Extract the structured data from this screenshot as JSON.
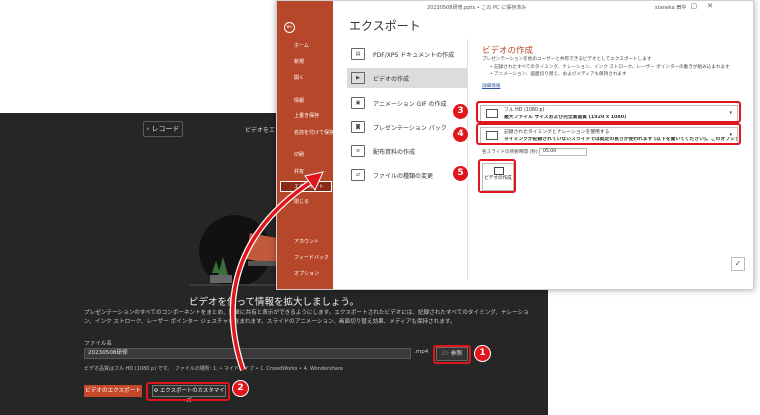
{
  "recorder": {
    "back_label": "レコード",
    "top_title": "ビデオをエクスポート",
    "heading": "ビデオを使って情報を拡大しましょう。",
    "description": "プレゼンテーションのすべてのコンポーネントをまとめ、簡単に共有と表示ができるようにします。エクスポートされたビデオには、記録されたすべてのタイミング、ナレーション、インク ストローク、レーザー ポインター ジェスチャが含まれます。スライドのアニメーション、画面切り替え効果、メディアも保持されます。",
    "filename_label": "ファイル名",
    "filename_value": "20230508研修",
    "extension": ".mp4",
    "browse_label": "参照",
    "quality_text": "ビデオ品質はフル HD (1080 p) です。　ファイルの場所: 1. • マイドライブ • 1. CrowdWorks • 4. Wondershare",
    "export_button": "ビデオのエクスポート",
    "customize_button": "エクスポートのカスタマイズ"
  },
  "ppt": {
    "filename": "20230508研修.pptx • この PC に保存済み",
    "user": "staneka 田中",
    "nav": [
      {
        "label": "ホーム",
        "icon": "home-icon"
      },
      {
        "label": "新規",
        "icon": "new-icon"
      },
      {
        "label": "開く",
        "icon": "open-icon"
      },
      {
        "label": "情報"
      },
      {
        "label": "上書き保存"
      },
      {
        "label": "名前を付けて保存"
      },
      {
        "label": "印刷"
      },
      {
        "label": "共有"
      },
      {
        "label": "エクスポート",
        "selected": true
      },
      {
        "label": "閉じる"
      },
      {
        "label": "アカウント"
      },
      {
        "label": "フィードバック"
      },
      {
        "label": "オプション"
      }
    ],
    "backstage_title": "エクスポート",
    "options": [
      {
        "label": "PDF/XPS ドキュメントの作成",
        "icon": "pdf-icon"
      },
      {
        "label": "ビデオの作成",
        "icon": "video-icon",
        "selected": true
      },
      {
        "label": "アニメーション GIF の作成",
        "icon": "gif-icon"
      },
      {
        "label": "プレゼンテーション パック",
        "icon": "package-icon"
      },
      {
        "label": "配布資料の作成",
        "icon": "handout-icon"
      },
      {
        "label": "ファイルの種類の変更",
        "icon": "filetype-icon"
      }
    ],
    "detail": {
      "title": "ビデオの作成",
      "desc": "プレゼンテーションを他のユーザーと共有できるビデオとしてエクスポートします",
      "bullets": [
        "記録されたすべてのタイミング、ナレーション、インク ストローク、レーザー ポインターの動きが組み込まれます",
        "アニメーション、画面切り替え、およびメディアも保持されます"
      ],
      "help_link": "詳細情報",
      "quality_line1": "フル HD (1080 p)",
      "quality_line2": "最大ファイル サイズおよび完全高画質 (1920 x 1080)",
      "timing_line1": "記録されたタイミングとナレーションを使用する",
      "timing_line2": "タイミングが記録されていないスライドでは既定の長さが使われます (以下を聞いてください)。このオプションは...",
      "seconds_label": "各スライドの所要時間 (秒):",
      "seconds_value": "05.00",
      "create_button": "ビデオの作成"
    }
  },
  "annotations": [
    "1",
    "2",
    "3",
    "4",
    "5"
  ],
  "colors": {
    "accent": "#b7472a",
    "highlight": "#e0161c",
    "dark_bg": "#262626"
  }
}
